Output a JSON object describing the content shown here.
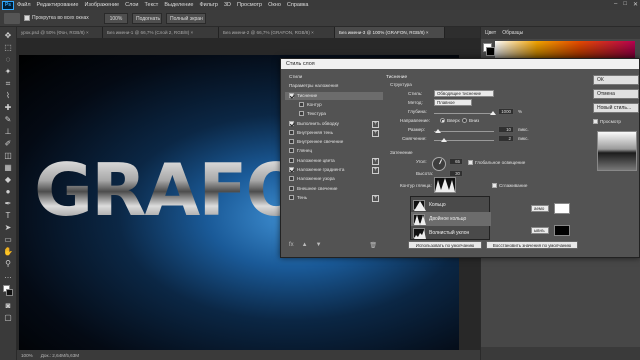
{
  "app": {
    "logo": "Ps"
  },
  "menu": [
    "Файл",
    "Редактирование",
    "Изображение",
    "Слои",
    "Текст",
    "Выделение",
    "Фильтр",
    "3D",
    "Просмотр",
    "Окно",
    "Справка"
  ],
  "options": {
    "checkbox_label": "Прокрутка во всех окнах",
    "zoom_value": "100%",
    "fit_button": "Подогнать",
    "fullscreen_button": "Полный экран"
  },
  "tabs": [
    "урок.psd @ 50% (Фон, RGB/8) ×",
    "Без имени-1 @ 66,7% (Слой 2, RGB/8) ×",
    "Без имени-2 @ 66,7% (GRAFON, RGB/8) ×",
    "Без имени-3 @ 100% (GRAFON, RGB/8) ×"
  ],
  "canvas": {
    "text": "GRAFON"
  },
  "status": {
    "zoom": "100%",
    "doc": "Док.: 2,64M/5,63M"
  },
  "right_panel": {
    "tab1": "Цвет",
    "tab2": "Образцы"
  },
  "dialog": {
    "title": "Стиль слоя",
    "styles_list": [
      {
        "label": "Стили",
        "checked": null,
        "sub": false,
        "plus": false,
        "sel": false
      },
      {
        "label": "Параметры наложения",
        "checked": null,
        "sub": false,
        "plus": false,
        "sel": false
      },
      {
        "label": "Тиснение",
        "checked": true,
        "sub": false,
        "plus": false,
        "sel": true
      },
      {
        "label": "Контур",
        "checked": false,
        "sub": true,
        "plus": false,
        "sel": false
      },
      {
        "label": "Текстура",
        "checked": false,
        "sub": true,
        "plus": false,
        "sel": false
      },
      {
        "label": "Выполнить обводку",
        "checked": true,
        "sub": false,
        "plus": true,
        "sel": false
      },
      {
        "label": "Внутренняя тень",
        "checked": false,
        "sub": false,
        "plus": true,
        "sel": false
      },
      {
        "label": "Внутреннее свечение",
        "checked": false,
        "sub": false,
        "plus": false,
        "sel": false
      },
      {
        "label": "Глянец",
        "checked": false,
        "sub": false,
        "plus": false,
        "sel": false
      },
      {
        "label": "Наложение цвета",
        "checked": false,
        "sub": false,
        "plus": true,
        "sel": false
      },
      {
        "label": "Наложение градиента",
        "checked": true,
        "sub": false,
        "plus": true,
        "sel": false
      },
      {
        "label": "Наложение узора",
        "checked": false,
        "sub": false,
        "plus": false,
        "sel": false
      },
      {
        "label": "Внешнее свечение",
        "checked": false,
        "sub": false,
        "plus": false,
        "sel": false
      },
      {
        "label": "Тень",
        "checked": false,
        "sub": false,
        "plus": true,
        "sel": false
      }
    ],
    "bevel": {
      "section_title": "Тиснение",
      "structure": "Структура",
      "style_label": "Стиль:",
      "style_value": "Обводящее тиснение",
      "method_label": "Метод:",
      "method_value": "Плавное",
      "depth_label": "Глубина:",
      "depth_value": "1000",
      "depth_unit": "%",
      "direction_label": "Направление:",
      "dir_up": "Вверх",
      "dir_down": "Вниз",
      "size_label": "Размер:",
      "size_value": "10",
      "size_unit": "пикс.",
      "soften_label": "Смягчение:",
      "soften_value": "2",
      "soften_unit": "пикс.",
      "shading": "Затенение",
      "angle_label": "Угол:",
      "angle_value": "65",
      "global_light": "Глобальное освещение",
      "altitude_label": "Высота:",
      "altitude_value": "30",
      "gloss_label": "Контур глянца:",
      "antialias": "Сглаживание",
      "default_btn": "Использовать по умолчанию",
      "reset_btn": "Восстановить значения по умолчанию",
      "mode_frag1": "аемо",
      "mode_frag2": "ывнъ"
    },
    "buttons": [
      "ОК",
      "Отмена",
      "Новый стиль...",
      "Просмотр"
    ],
    "contours": [
      "Кольцо",
      "Двойное кольцо",
      "Волнистый уклон"
    ]
  }
}
